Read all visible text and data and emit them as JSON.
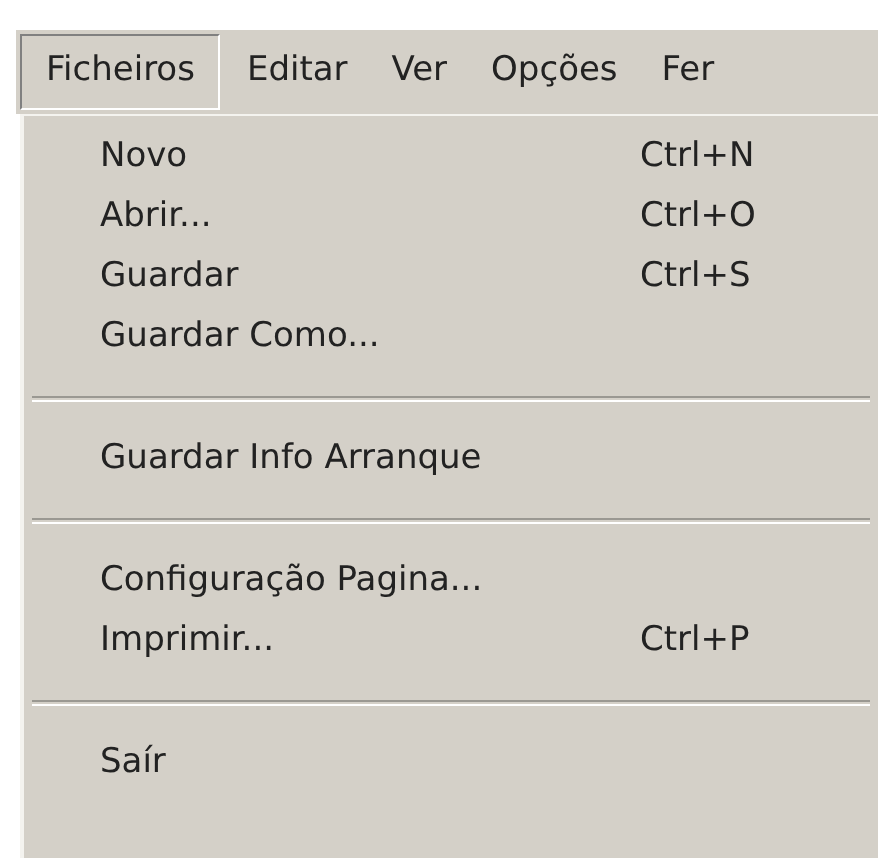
{
  "menu_bar": [
    {
      "label": "Ficheiros",
      "selected": true
    },
    {
      "label": "Editar",
      "selected": false
    },
    {
      "label": "Ver",
      "selected": false
    },
    {
      "label": "Opções",
      "selected": false
    },
    {
      "label": "Fer",
      "selected": false
    }
  ],
  "menu": [
    {
      "kind": "item",
      "label": "Novo",
      "shortcut": "Ctrl+N"
    },
    {
      "kind": "item",
      "label": "Abrir...",
      "shortcut": "Ctrl+O"
    },
    {
      "kind": "item",
      "label": "Guardar",
      "shortcut": "Ctrl+S"
    },
    {
      "kind": "item",
      "label": "Guardar Como..."
    },
    {
      "kind": "separator"
    },
    {
      "kind": "item",
      "label": "Guardar Info Arranque"
    },
    {
      "kind": "separator"
    },
    {
      "kind": "item",
      "label": "Configuração Pagina..."
    },
    {
      "kind": "item",
      "label": "Imprimir...",
      "shortcut": "Ctrl+P"
    },
    {
      "kind": "separator"
    },
    {
      "kind": "item",
      "label": "Saír"
    }
  ]
}
